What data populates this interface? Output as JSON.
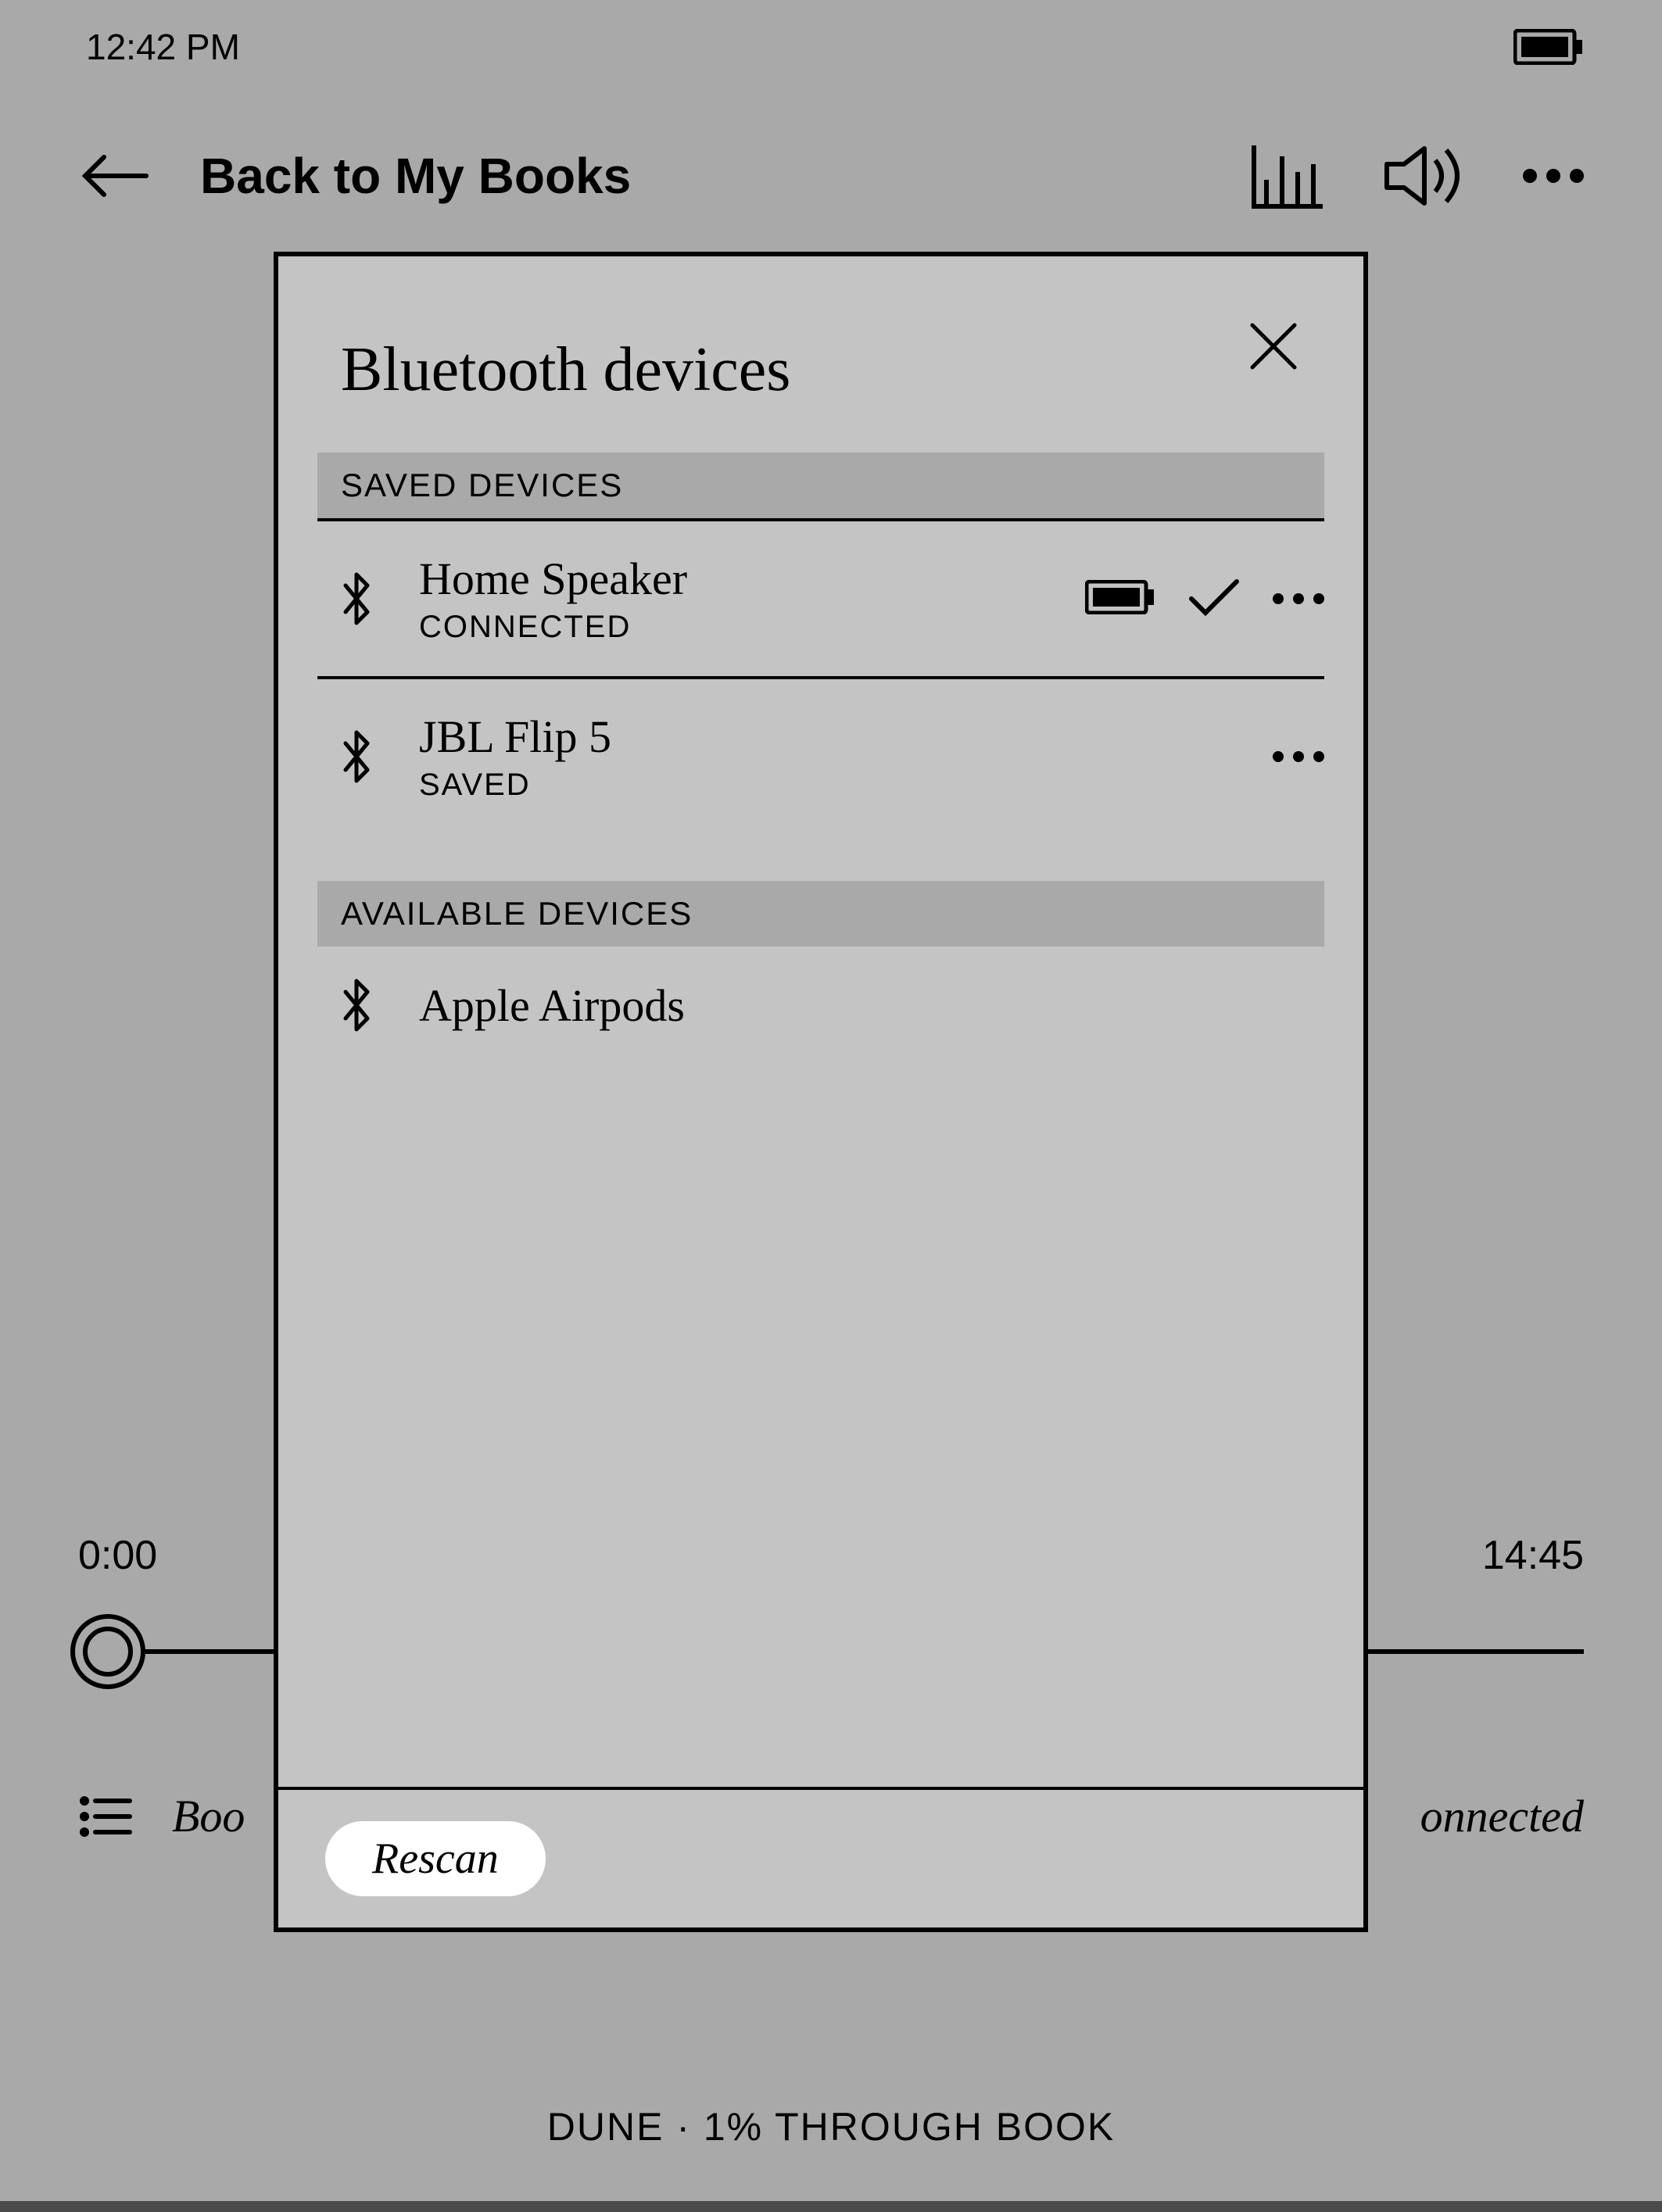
{
  "status": {
    "time": "12:42 PM"
  },
  "header": {
    "back_label": "Back to My Books"
  },
  "player": {
    "elapsed": "0:00",
    "remaining": "14:45"
  },
  "bottom": {
    "left_partial": "Boo",
    "right_partial": "onnected"
  },
  "footer": {
    "progress": "DUNE · 1% THROUGH BOOK"
  },
  "dialog": {
    "title": "Bluetooth devices",
    "saved_header": "SAVED DEVICES",
    "available_header": "AVAILABLE DEVICES",
    "rescan_label": "Rescan",
    "saved": [
      {
        "name": "Home Speaker",
        "status": "CONNECTED",
        "connected": true
      },
      {
        "name": "JBL Flip 5",
        "status": "SAVED",
        "connected": false
      }
    ],
    "available": [
      {
        "name": "Apple Airpods"
      }
    ]
  }
}
